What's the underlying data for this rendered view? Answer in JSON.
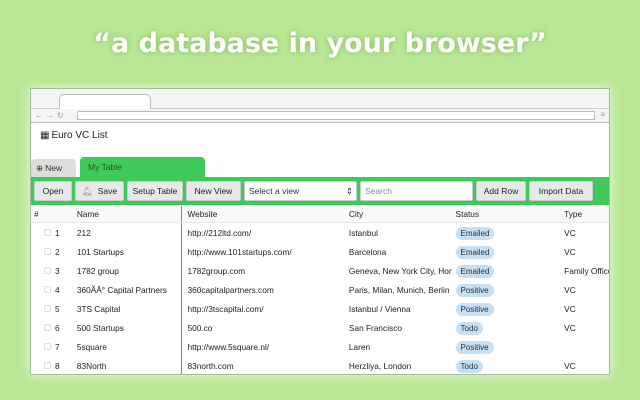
{
  "headline": "“a database in your browser”",
  "app": {
    "title": "Euro VC List",
    "tabs": {
      "new": "New",
      "current": "My Table"
    }
  },
  "toolbar": {
    "open": "Open",
    "save": "Save",
    "setup": "Setup Table",
    "new_view": "New View",
    "select_view": "Select a view",
    "search_placeholder": "Search",
    "add_row": "Add Row",
    "import": "Import Data"
  },
  "columns": [
    "#",
    "Name",
    "Website",
    "City",
    "Status",
    "Type"
  ],
  "rows": [
    {
      "n": "1",
      "name": "212",
      "website": "http://212ltd.com/",
      "city": "Istanbul",
      "status": "Emailed",
      "type": "VC"
    },
    {
      "n": "2",
      "name": "101 Startups",
      "website": "http://www.101startups.com/",
      "city": "Barcelona",
      "status": "Emailed",
      "type": "VC"
    },
    {
      "n": "3",
      "name": "1782 group",
      "website": "1782group.com",
      "city": "Geneva, New York City, Hong",
      "status": "Emailed",
      "type": "Family Office"
    },
    {
      "n": "4",
      "name": "360ÃÂ° Capital Partners",
      "website": "360capitalpartners.com",
      "city": "Paris, Milan, Munich, Berlin",
      "status": "Positive",
      "type": "VC"
    },
    {
      "n": "5",
      "name": "3TS Capital",
      "website": "http://3tscapital.com/",
      "city": "Istanbul / Vienna",
      "status": "Positive",
      "type": "VC"
    },
    {
      "n": "6",
      "name": "500 Startups",
      "website": "500.co",
      "city": "San Francisco",
      "status": "Todo",
      "type": "VC"
    },
    {
      "n": "7",
      "name": "5square",
      "website": "http://www.5square.nl/",
      "city": "Laren",
      "status": "Positive",
      "type": ""
    },
    {
      "n": "8",
      "name": "83North",
      "website": "83north.com",
      "city": "Herzliya, London",
      "status": "Todo",
      "type": "VC"
    }
  ]
}
